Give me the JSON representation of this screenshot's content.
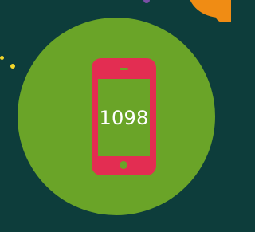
{
  "stat": {
    "value": "1098",
    "icon": "smartphone-icon"
  },
  "colors": {
    "background": "#0d3d3b",
    "circle": "#6aa428",
    "phone": "#e32d52",
    "accent_orange": "#f08c14",
    "accent_yellow": "#f4d72a",
    "accent_purple": "#7b4fa6",
    "text": "#ffffff"
  }
}
